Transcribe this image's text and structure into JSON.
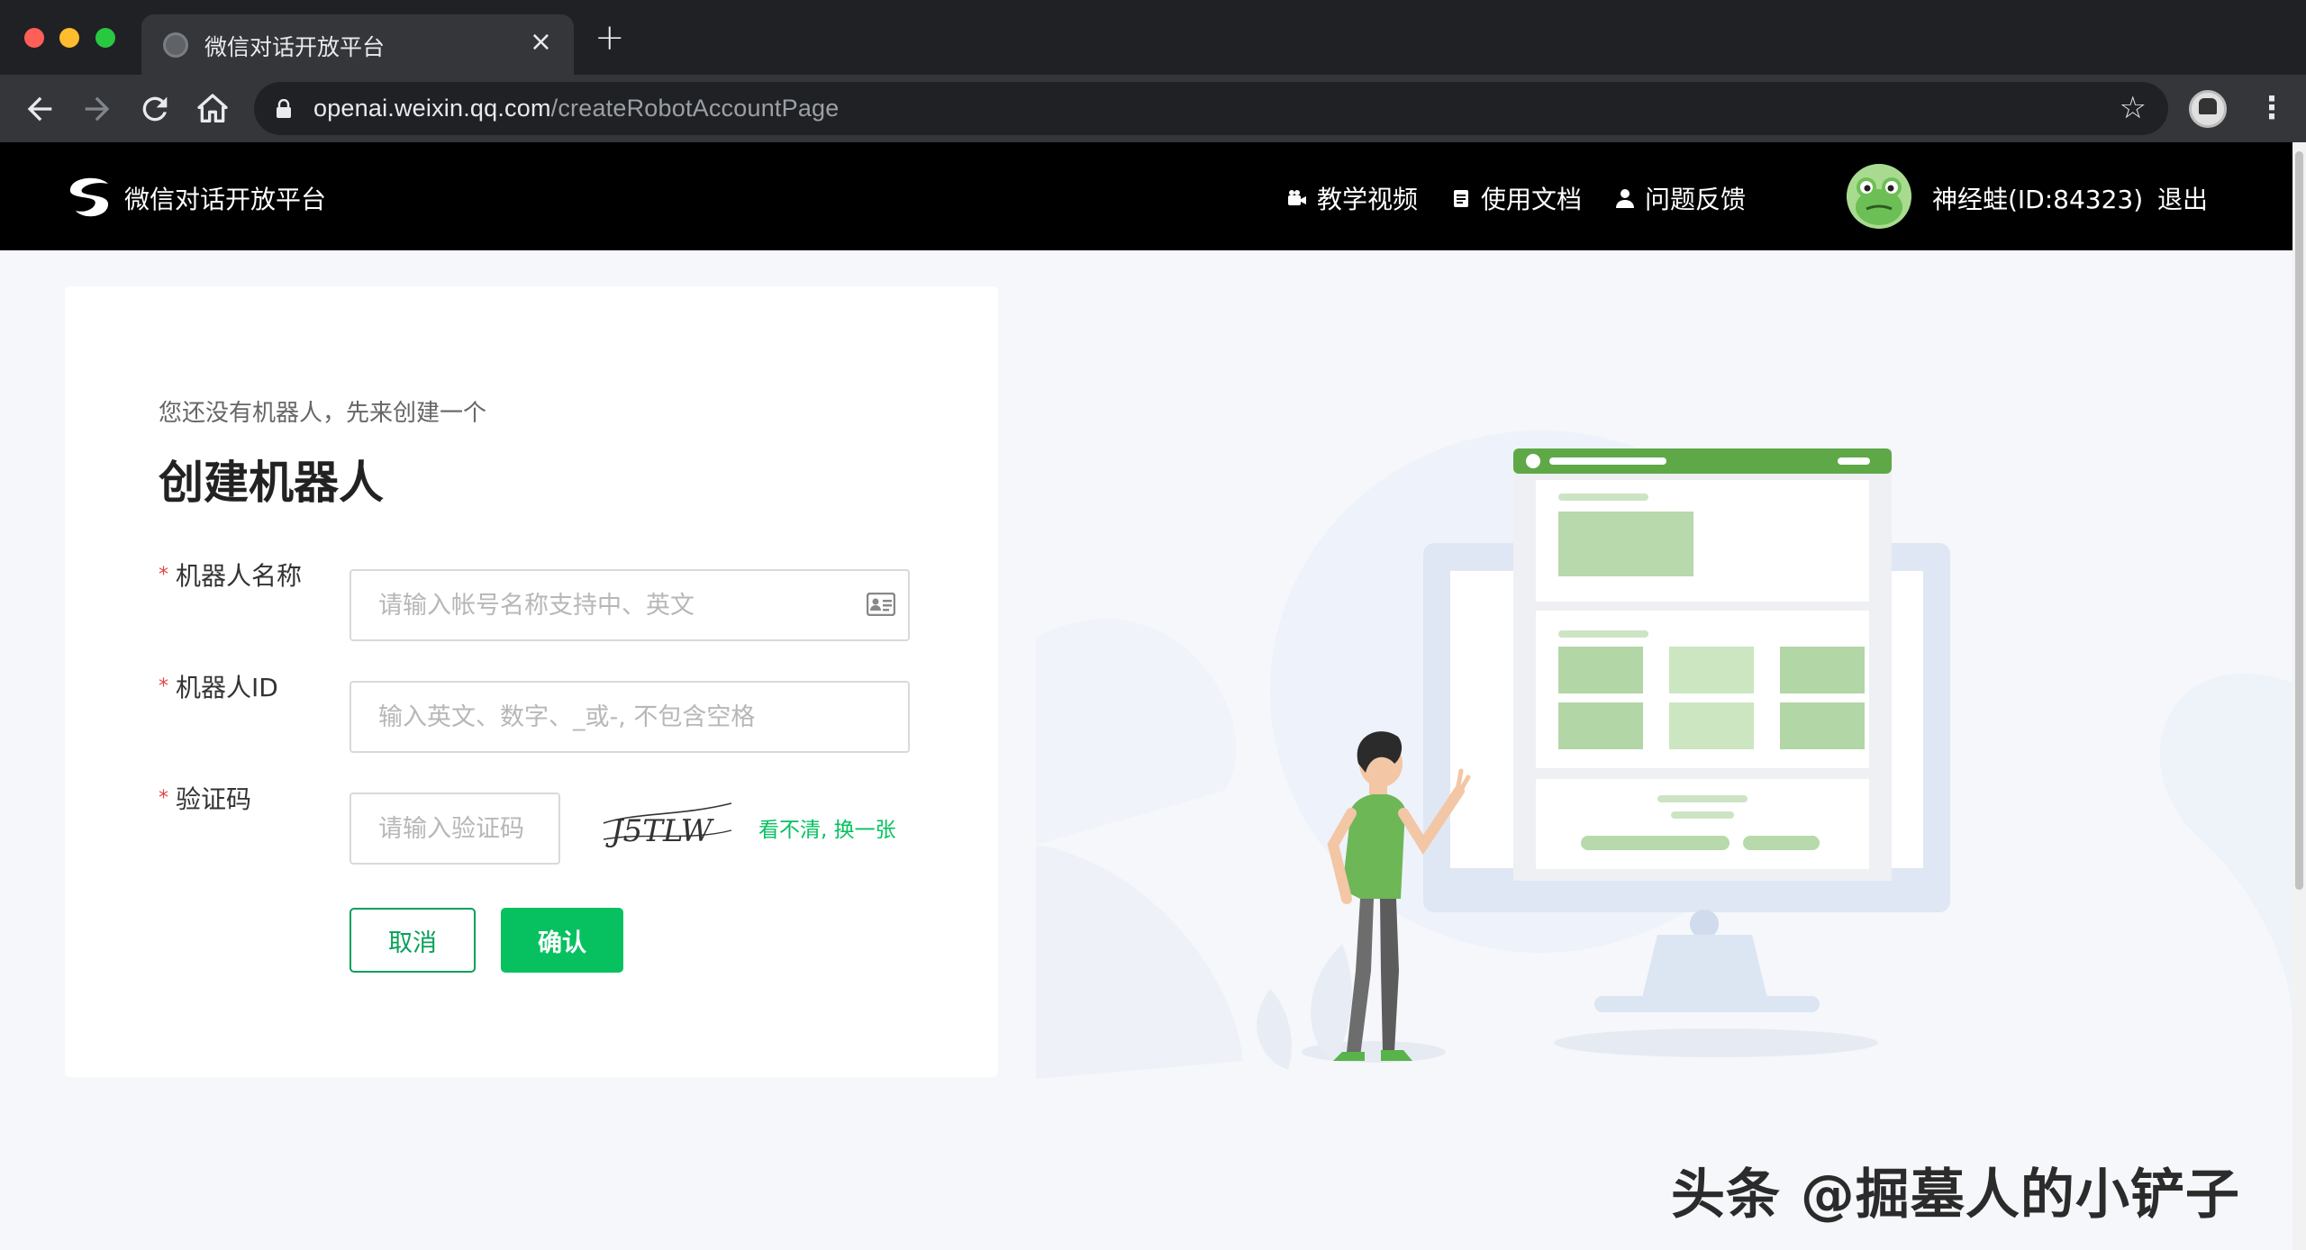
{
  "browser": {
    "tab_title": "微信对话开放平台",
    "tab_close": "×",
    "new_tab": "+",
    "url_host": "openai.weixin.qq.com",
    "url_path": "/createRobotAccountPage",
    "bookmark_star": "☆",
    "menu": "⋮"
  },
  "header": {
    "logo_text": "微信对话开放平台",
    "nav": [
      {
        "label": "教学视频",
        "icon": "video-camera-icon"
      },
      {
        "label": "使用文档",
        "icon": "document-icon"
      },
      {
        "label": "问题反馈",
        "icon": "user-icon"
      }
    ],
    "username": "神经蛙(ID:84323)",
    "logout": "退出"
  },
  "form": {
    "subtitle": "您还没有机器人，先来创建一个",
    "title": "创建机器人",
    "required_mark": "*",
    "name_label": "机器人名称",
    "name_placeholder": "请输入帐号名称支持中、英文",
    "id_label": "机器人ID",
    "id_placeholder": "输入英文、数字、_或-, 不包含空格",
    "captcha_label": "验证码",
    "captcha_placeholder": "请输入验证码",
    "captcha_text": "J5TLW",
    "captcha_refresh": "看不清, 换一张",
    "cancel": "取消",
    "confirm": "确认"
  },
  "watermark": "头条 @掘墓人的小铲子",
  "colors": {
    "accent": "#07c160",
    "header_bg": "#000000",
    "page_bg": "#f5f7fb",
    "required": "#e54545"
  }
}
